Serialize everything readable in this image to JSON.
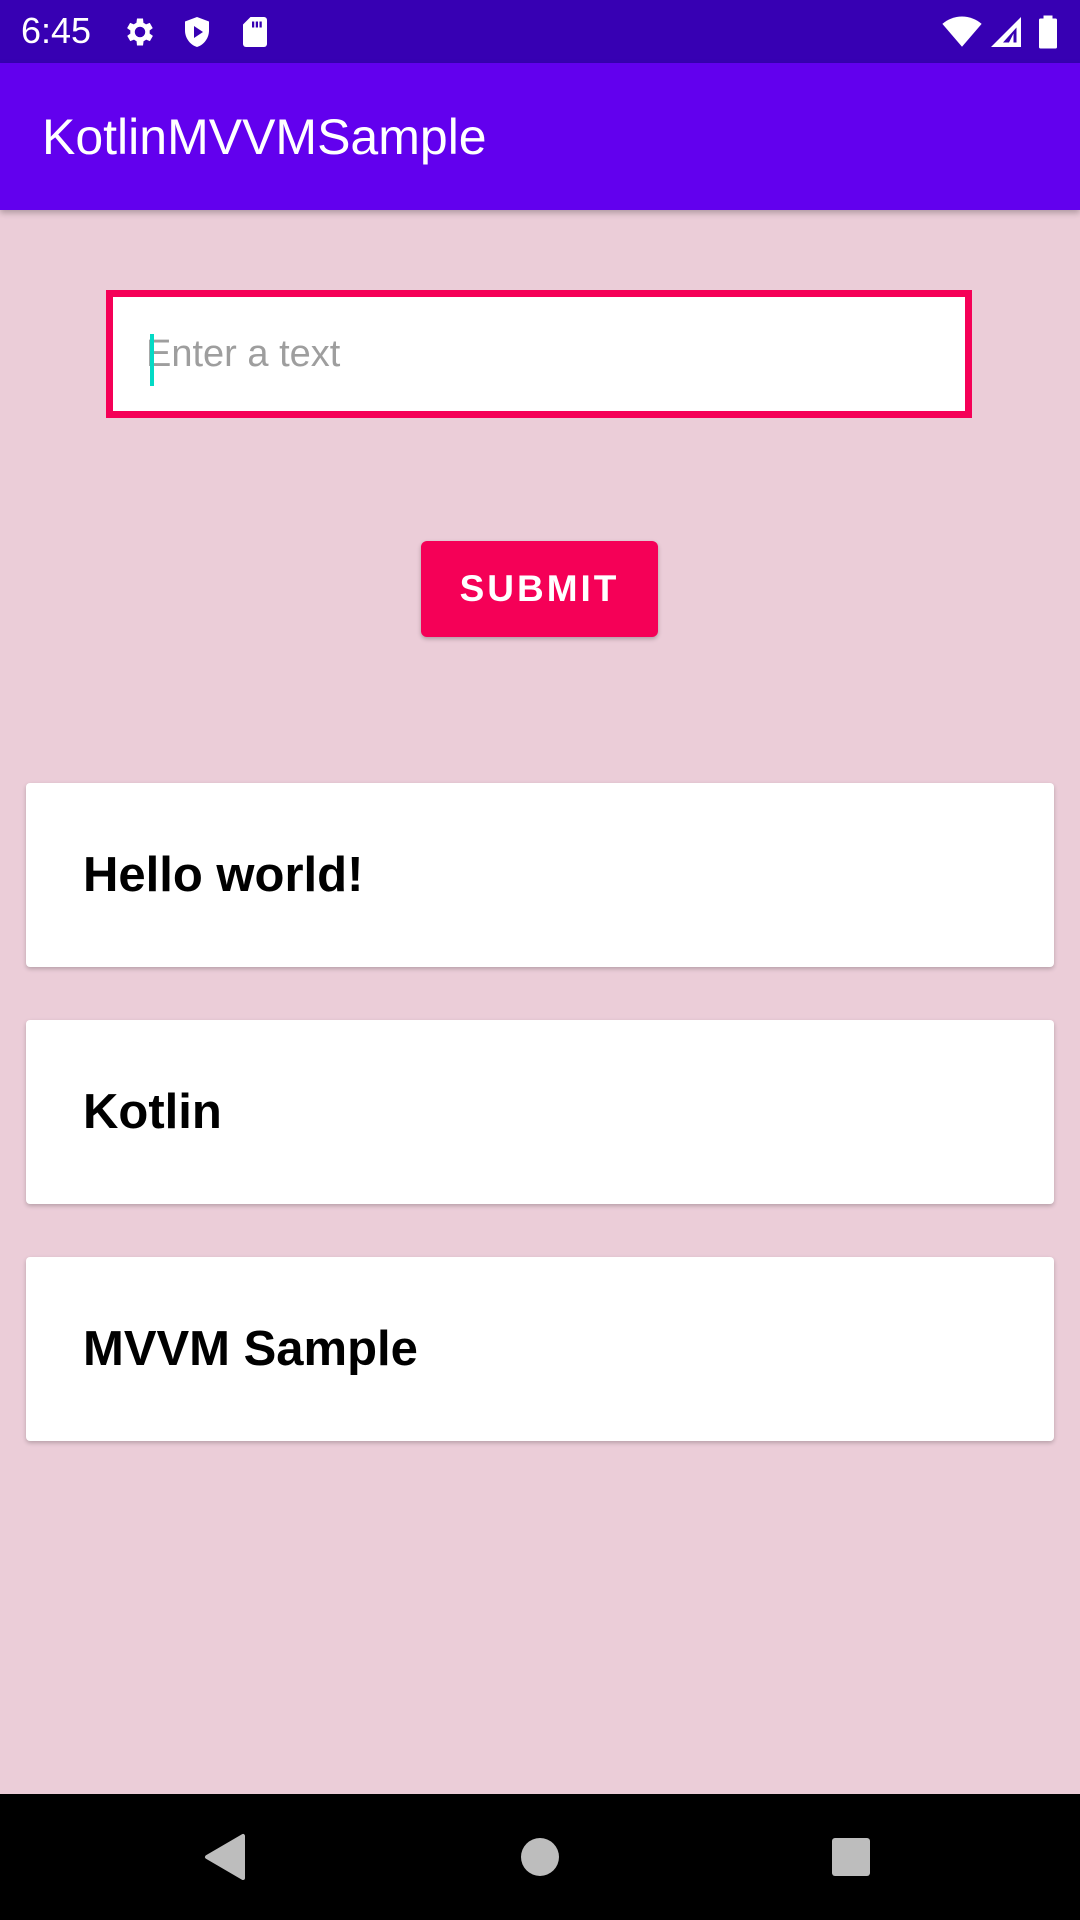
{
  "status_bar": {
    "time": "6:45",
    "left_icons": [
      "gear-icon",
      "shield-play-icon",
      "sd-card-icon"
    ],
    "right_icons": [
      "wifi-icon",
      "signal-icon",
      "battery-icon"
    ],
    "background": "#3700b3"
  },
  "app_bar": {
    "title": "KotlinMVVMSample",
    "background": "#6200ee"
  },
  "input": {
    "placeholder": "Enter a text",
    "value": "",
    "border_color": "#f50057",
    "cursor_color": "#03dac5"
  },
  "submit_button": {
    "label": "SUBMIT",
    "background": "#f50057"
  },
  "list": {
    "items": [
      {
        "text": "Hello world!"
      },
      {
        "text": "Kotlin"
      },
      {
        "text": "MVVM Sample"
      }
    ]
  },
  "screen": {
    "background": "#ebcdd8"
  },
  "nav_bar": {
    "buttons": [
      "back-icon",
      "home-icon",
      "recents-icon"
    ]
  }
}
